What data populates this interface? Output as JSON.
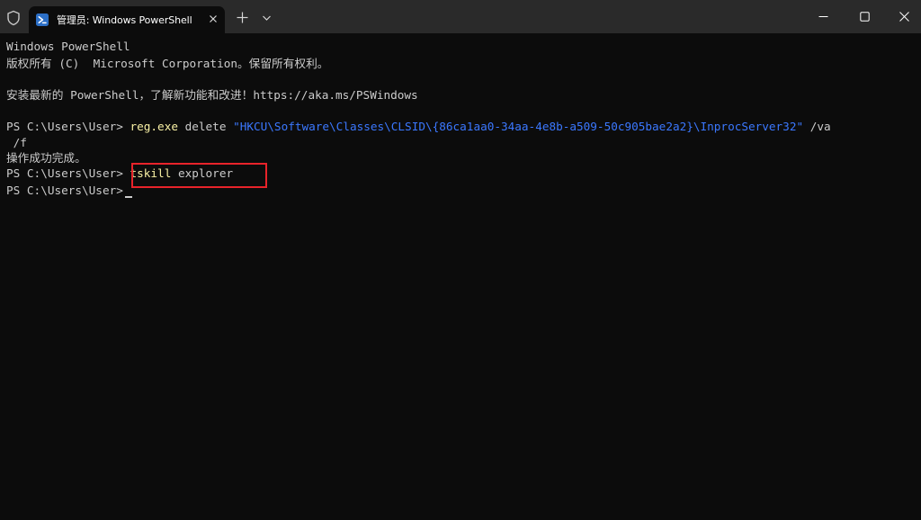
{
  "window": {
    "tab_title": "管理员: Windows PowerShell"
  },
  "terminal": {
    "banner_line1": "Windows PowerShell",
    "banner_line2": "版权所有 (C)  Microsoft Corporation。保留所有权利。",
    "banner_line3": "安装最新的 PowerShell，了解新功能和改进！https://aka.ms/PSWindows",
    "prompt": "PS C:\\Users\\User> ",
    "cmd1_name": "reg.exe",
    "cmd1_args": " delete ",
    "cmd1_path": "\"HKCU\\Software\\Classes\\CLSID\\{86ca1aa0-34aa-4e8b-a509-50c905bae2a2}\\InprocServer32\"",
    "cmd1_flag1": " /va",
    "cmd1_flag2": " /f",
    "cmd1_result": "操作成功完成。",
    "cmd2_name": "tskill",
    "cmd2_args": " explorer",
    "highlight_color": "#e8232a"
  },
  "colors": {
    "background": "#0c0c0c",
    "titlebar": "#2a2a2a",
    "text": "#cccccc",
    "command": "#f9f1a5",
    "string": "#3b78ff"
  },
  "icons": {
    "shield": "shield-icon",
    "powershell": "powershell-icon",
    "close": "close-icon",
    "new_tab": "plus-icon",
    "dropdown": "chevron-down-icon",
    "minimize": "minimize-icon",
    "maximize": "maximize-icon"
  }
}
